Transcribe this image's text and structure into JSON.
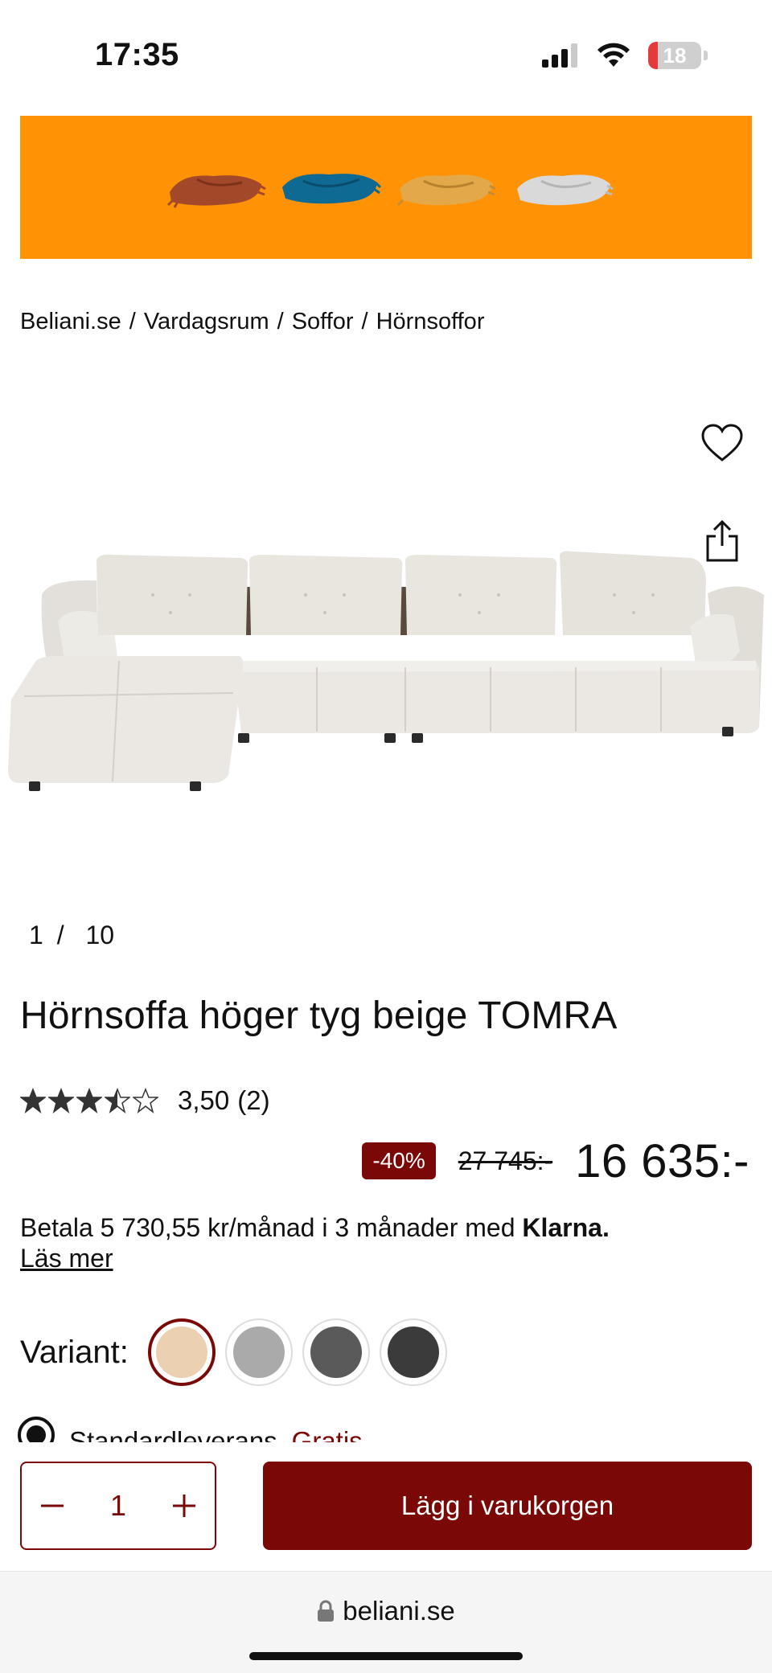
{
  "status_bar": {
    "time": "17:35",
    "battery_level": "18",
    "battery_fraction": 0.18,
    "icons": [
      "signal-icon",
      "wifi-icon",
      "battery-icon"
    ]
  },
  "promo_banner": {
    "background": "#ff9305",
    "blanket_colors": [
      "#a4482a",
      "#0e6a92",
      "#e3a84a",
      "#d9d9d9"
    ]
  },
  "breadcrumb": {
    "items": [
      "Beliani.se",
      "Vardagsrum",
      "Soffor",
      "Hörnsoffor"
    ],
    "separator": "/"
  },
  "gallery": {
    "current": "1",
    "separator": "/",
    "total": "10",
    "actions": [
      "heart-icon",
      "share-icon"
    ]
  },
  "product": {
    "title": "Hörnsoffa höger tyg beige TOMRA",
    "rating_value": "3,50",
    "rating_count": "(2)",
    "rating_stars": 3.5,
    "rating_max": 5
  },
  "price": {
    "discount": "-40%",
    "old": "27 745:-",
    "new": "16 635:-"
  },
  "klarna": {
    "text": "Betala 5 730,55 kr/månad i 3 månader med",
    "brand": "Klarna.",
    "link": "Läs mer"
  },
  "variant": {
    "label": "Variant:",
    "swatches": [
      "#ecd0b2",
      "#aaaaaa",
      "#5a5a5a",
      "#3c3b3b"
    ],
    "selected_index": 0
  },
  "delivery": {
    "label": "Standardleverans",
    "price": "Gratis"
  },
  "cart": {
    "quantity": "1",
    "add_label": "Lägg i varukorgen"
  },
  "browser": {
    "url": "beliani.se"
  },
  "colors": {
    "accent": "#7a0806",
    "promo_orange": "#ff9305"
  }
}
